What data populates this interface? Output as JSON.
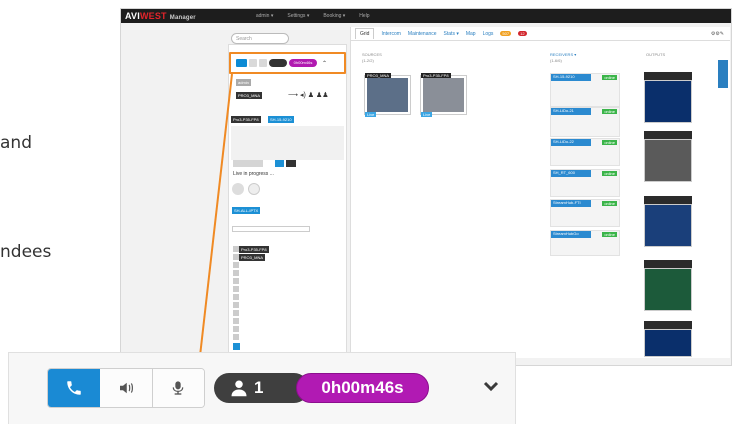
{
  "slide": {
    "fragment_1": "and",
    "fragment_2": "ndees"
  },
  "app": {
    "brand_a": "AVI",
    "brand_b": "WEST",
    "brand_c": "Manager",
    "nav": [
      "admin ▾",
      "Settings ▾",
      "Booking ▾",
      "Help"
    ],
    "search_placeholder": "Search",
    "tabs": [
      "Grid",
      "Intercom",
      "Maintenance",
      "Stats ▾",
      "Map",
      "Logs"
    ],
    "logs_badge_warn": "507",
    "logs_badge_err": "12",
    "col_sources": "SOURCES",
    "col_sources_sub": "(1-2/2)",
    "col_receivers": "RECEIVERS ▾",
    "col_receivers_sub": "(1-6/6)",
    "col_outputs": "OUTPUTS",
    "sources": [
      {
        "name": "PRO3_MNA",
        "tag": "Live"
      },
      {
        "name": "Pro3-P35-FP8",
        "tag": "Live"
      }
    ],
    "receivers": [
      {
        "name": "SH-15-9210",
        "status": "online"
      },
      {
        "name": "SH-LiDo-21",
        "status": "online"
      },
      {
        "name": "SH-LiDo-22",
        "status": "online"
      },
      {
        "name": "SH_RT_600",
        "status": "online"
      },
      {
        "name": "StreamHub-FTI",
        "status": "online"
      },
      {
        "name": "StreamHubGo",
        "status": "online"
      }
    ],
    "left_labels": {
      "admin": "admin",
      "device": "PRO3_MNA",
      "device2": "Pro3-P35-FP8",
      "badge_id": "SH-15-9210",
      "live": "Live in progress ...",
      "group": "SH-ALL-IPTX"
    },
    "mini_duration": "0h00m46s"
  },
  "callbar": {
    "attendee_count": "1",
    "duration": "0h00m46s",
    "buttons": [
      "phone",
      "speaker",
      "microphone"
    ],
    "active_button": "phone",
    "accent": "#1a8ad4",
    "duration_color": "#b11ab3",
    "highlight_color": "#f08a24"
  }
}
